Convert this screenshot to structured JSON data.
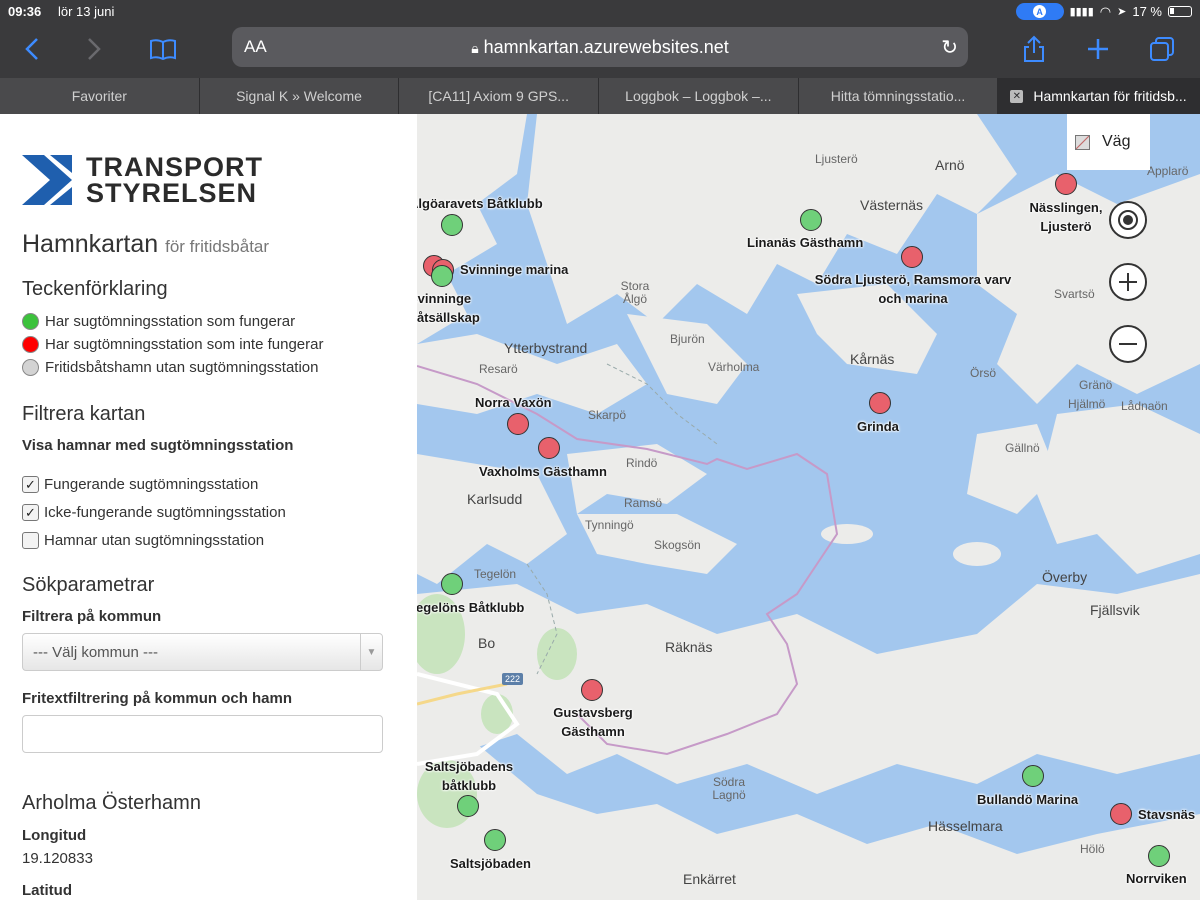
{
  "status": {
    "time": "09:36",
    "date": "lör 13 juni",
    "battery": "17 %"
  },
  "browser": {
    "aa_label": "AA",
    "url": "hamnkartan.azurewebsites.net",
    "tabs": [
      {
        "label": "Favoriter"
      },
      {
        "label": "Signal K » Welcome"
      },
      {
        "label": "[CA11] Axiom 9 GPS..."
      },
      {
        "label": "Loggbok – Loggbok –..."
      },
      {
        "label": "Hitta tömningsstatio..."
      },
      {
        "label": "Hamnkartan för fritidsb..."
      }
    ]
  },
  "sidebar": {
    "logo": {
      "line1": "TRANSPORT",
      "line2": "STYRELSEN"
    },
    "title": "Hamnkartan",
    "subtitle": "för fritidsbåtar",
    "legend": {
      "heading": "Teckenförklaring",
      "items": [
        {
          "label": "Har sugtömningsstation som fungerar",
          "color": "#3cc23c"
        },
        {
          "label": "Har sugtömningsstation som inte fungerar",
          "color": "#ff0000"
        },
        {
          "label": "Fritidsbåtshamn utan sugtömningsstation",
          "color": "#d3d3d3"
        }
      ]
    },
    "filter": {
      "heading": "Filtrera kartan",
      "subheading": "Visa hamnar med sugtömningsstation",
      "options": [
        {
          "label": "Fungerande sugtömningsstation",
          "checked": true
        },
        {
          "label": "Icke-fungerande sugtömningsstation",
          "checked": true
        },
        {
          "label": "Hamnar utan sugtömningsstation",
          "checked": false
        }
      ]
    },
    "search": {
      "heading": "Sökparametrar",
      "kommun_label": "Filtrera på kommun",
      "kommun_selected": "--- Välj kommun ---",
      "freetext_label": "Fritextfiltrering på kommun och hamn",
      "freetext_value": ""
    },
    "detail": {
      "name": "Arholma Österhamn",
      "longitude_label": "Longitud",
      "longitude_value": "19.120833",
      "latitude_label": "Latitud"
    }
  },
  "map": {
    "layer_label": "Väg",
    "road_number": "222",
    "places": [
      "Ljusterö",
      "Arnö",
      "Västernäs",
      "Applarö",
      "Stora Ålgö",
      "Svartsö",
      "Ytterbystrand",
      "Resarö",
      "Bjurön",
      "Värholma",
      "Kårnäs",
      "Örsö",
      "Gränö",
      "Hjälmö",
      "Lådnaön",
      "Skarpö",
      "Rindö",
      "Gällnö",
      "Karlsudd",
      "Ramsö",
      "Tynningö",
      "Skogsön",
      "Tegelön",
      "Överby",
      "Fjällsvik",
      "Bo",
      "Räknäs",
      "Södra Lagnö",
      "Hässelmara",
      "Hölö",
      "Enkärret"
    ],
    "harbors": [
      {
        "name": "Älgöaravets Båtklubb",
        "status": "green"
      },
      {
        "name": "Svinninge marina",
        "status": "red"
      },
      {
        "name": "Svinninge båtsällskap",
        "status": "green"
      },
      {
        "name": "Linanäs Gästhamn",
        "status": "green"
      },
      {
        "name": "Södra Ljusterö, Ramsmora varv och marina",
        "status": "red"
      },
      {
        "name": "Nässlingen, Ljusterö",
        "status": "red"
      },
      {
        "name": "Norra Vaxön",
        "status": "red"
      },
      {
        "name": "Vaxholms Gästhamn",
        "status": "red"
      },
      {
        "name": "Grinda",
        "status": "red"
      },
      {
        "name": "Tegelöns Båtklubb",
        "status": "green"
      },
      {
        "name": "Gustavsberg Gästhamn",
        "status": "red"
      },
      {
        "name": "Saltsjöbadens båtklubb",
        "status": "green"
      },
      {
        "name": "Saltsjöbaden",
        "status": "green"
      },
      {
        "name": "Bullandö Marina",
        "status": "green"
      },
      {
        "name": "Stavsnäs",
        "status": "red"
      },
      {
        "name": "Norrviken",
        "status": "green"
      }
    ]
  }
}
